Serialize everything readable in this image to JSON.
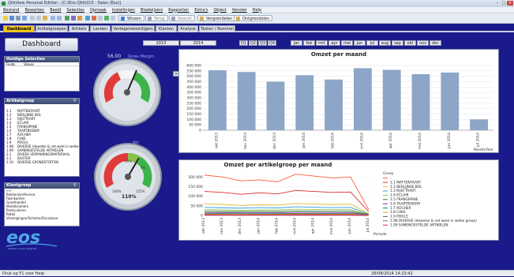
{
  "window": {
    "title": "QlikView Personal Edition - [C:\\Eos-Qlik\\015 - Sales (Eos)]"
  },
  "menu": [
    "Bestand",
    "Bewerken",
    "Beeld",
    "Selecties",
    "Opmaak",
    "Instellingen",
    "Bladwijzers",
    "Rapporten",
    "Extra's",
    "Object",
    "Venster",
    "Help"
  ],
  "toolbar": {
    "wissen_label": "Wissen",
    "terug_label": "Terug",
    "vooruit_label": "Vooruit",
    "vergendelen_label": "Vergrendelen",
    "ontgrendelen_label": "Ontgrendelen"
  },
  "tabs": [
    "Dashboard",
    "Artikelgroepen",
    "Artikels",
    "Landen",
    "Vertegenwoordigers",
    "Klanten",
    "Analyse",
    "Testen / Rommel"
  ],
  "page_title": "Dashboard",
  "years": [
    "2013",
    "2014"
  ],
  "quarters": [
    "Q1",
    "Q2",
    "Q3",
    "Q4"
  ],
  "months": [
    "jan",
    "feb",
    "mrt",
    "apr",
    "mei",
    "jun",
    "jul",
    "aug",
    "sep",
    "okt",
    "nov",
    "dec"
  ],
  "selections": {
    "title": "Huidige Selecties",
    "col_field": "Fields",
    "col_values": "Values"
  },
  "artikelgroep": {
    "title": "Artikelgroep",
    "items": [
      {
        "code": "1.1",
        "name": "MATTENTAART"
      },
      {
        "code": "1.2",
        "name": "BERLIJNSE BOL"
      },
      {
        "code": "1.3",
        "name": "RIJSTTAART"
      },
      {
        "code": "1.4",
        "name": "ECLAIR"
      },
      {
        "code": "1.5",
        "name": "FRANGIPANE"
      },
      {
        "code": "1.6",
        "name": "TAARTBODEM"
      },
      {
        "code": "1.7",
        "name": "ROCHER"
      },
      {
        "code": "1.8",
        "name": "CAKE"
      },
      {
        "code": "1.9",
        "name": "POOLS"
      },
      {
        "code": "1.98",
        "name": "DIVERSE (deweike & net weet in welke groep)"
      },
      {
        "code": "1.99",
        "name": "SAMENGESTELDE ARTIKELEN"
      },
      {
        "code": "2.1",
        "name": "DIVERS VERPAKKINGSMATERIAAL"
      },
      {
        "code": "3.1",
        "name": "BLISTER"
      },
      {
        "code": "3.10",
        "name": "DIVERSE GRONDSTOFFEN"
      }
    ]
  },
  "klantgroep": {
    "title": "Klantgroep",
    "items": [
      "<>",
      "Bakkerijen/Horeca",
      "Fabrikanten",
      "Groothandel",
      "Marktkramers",
      "Particulieren",
      "Retail",
      "Verenigingen/Scholen/Occasione"
    ]
  },
  "gauges": {
    "g1_value_label": "56.00",
    "g1_caption": "Gross Margin",
    "g1_side_label": "56",
    "g2_caption": "Vol.",
    "g2_inner_top": "10%",
    "g2_inner_right": "4%",
    "g2_readout": "110%",
    "g2_low": "100%",
    "g2_high": "125%"
  },
  "logo": {
    "tagline": "partner in your progress"
  },
  "chart_data": [
    {
      "type": "bar",
      "title": "Omzet per maand",
      "xlabel": "Month/Year",
      "categories": [
        "okt 2013",
        "nov 2013",
        "dec 2013",
        "jan 2014",
        "feb 2014",
        "mrt 2014",
        "apr 2014",
        "mei 2014",
        "jun 2014",
        "jul 2014"
      ],
      "values": [
        556000,
        540000,
        450000,
        510000,
        470000,
        575000,
        560000,
        520000,
        535000,
        100000
      ],
      "ylim": [
        0,
        600000
      ],
      "yticks": [
        "0",
        "50 000",
        "100 000",
        "150 000",
        "200 000",
        "250 000",
        "300 000",
        "350 000",
        "400 000",
        "450 000",
        "500 000",
        "550 000",
        "600 000"
      ],
      "color": "#8da6c8",
      "grid": true
    },
    {
      "type": "line",
      "title": "Omzet per artikelgroep per maand",
      "xlabel": "Periode",
      "legend_title": "Groep",
      "categories": [
        "okt 2013",
        "nov 2013",
        "dec 2013",
        "jan 2014",
        "feb 2014",
        "mrt 2014",
        "apr 2014",
        "mei 2014",
        "jun 2014",
        "jul 2014"
      ],
      "ylim": [
        0,
        230000
      ],
      "yticks": [
        "0",
        "50 000",
        "100 000",
        "150 000",
        "200 000"
      ],
      "series": [
        {
          "name": "-",
          "color": "#ff5a3c",
          "values": [
            210000,
            200000,
            180000,
            185000,
            175000,
            215000,
            205000,
            195000,
            200000,
            30000
          ]
        },
        {
          "name": "1.1",
          "color": "#d92b2b",
          "values": [
            125000,
            120000,
            110000,
            118000,
            112000,
            130000,
            125000,
            120000,
            122000,
            20000
          ]
        },
        {
          "name": "1.2",
          "color": "#e0c030",
          "values": [
            60000,
            58000,
            52000,
            56000,
            54000,
            62000,
            60000,
            57000,
            59000,
            9000
          ]
        },
        {
          "name": "1.3",
          "color": "#3b9fd6",
          "values": [
            42000,
            40000,
            38000,
            41000,
            39000,
            45000,
            43000,
            41000,
            42000,
            7000
          ]
        },
        {
          "name": "1.4",
          "color": "#8bc34a",
          "values": [
            30000,
            29000,
            27000,
            29000,
            28000,
            32000,
            31000,
            30000,
            30000,
            5000
          ]
        },
        {
          "name": "1.5",
          "color": "#2e7d32",
          "values": [
            22000,
            21000,
            20000,
            21500,
            20500,
            23000,
            22500,
            22000,
            22000,
            4000
          ]
        },
        {
          "name": "1.6",
          "color": "#9c27b0",
          "values": [
            15000,
            14500,
            13500,
            14000,
            13800,
            16000,
            15500,
            15000,
            15200,
            3000
          ]
        },
        {
          "name": "1.7",
          "color": "#00897b",
          "values": [
            10000,
            9800,
            9000,
            9500,
            9200,
            10500,
            10200,
            10000,
            10100,
            2000
          ]
        },
        {
          "name": "1.8",
          "color": "#ff9800",
          "values": [
            7000,
            6800,
            6200,
            6600,
            6400,
            7400,
            7100,
            6900,
            7000,
            1500
          ]
        },
        {
          "name": "1.9",
          "color": "#795548",
          "values": [
            4000,
            3900,
            3500,
            3800,
            3700,
            4200,
            4100,
            4000,
            4000,
            800
          ]
        },
        {
          "name": "1.98",
          "color": "#607d8b",
          "values": [
            2500,
            2400,
            2200,
            2300,
            2250,
            2600,
            2500,
            2450,
            2500,
            500
          ]
        },
        {
          "name": "1.99",
          "color": "#e91e63",
          "values": [
            1500,
            1450,
            1300,
            1400,
            1350,
            1550,
            1500,
            1450,
            1480,
            300
          ]
        }
      ],
      "legend_labels": [
        "-",
        "1.1   MATTENTAART",
        "1.2   BERLIJNSE BOL",
        "1.3   RIJSTTAART",
        "1.4   ECLAIR",
        "1.5   FRANGIPANE",
        "1.6   TAARTBODEM",
        "1.7   ROCHER",
        "1.8   CAKE",
        "1.9   POOLS",
        "1.98  DIVERSE (deweike & net weet in welke groep)",
        "1.99  SAMENGESTELDE ARTIKELEN"
      ]
    }
  ],
  "status": {
    "left": "Druk op F1 voor Help",
    "datetime": "28/08/2014 14:23:42"
  }
}
